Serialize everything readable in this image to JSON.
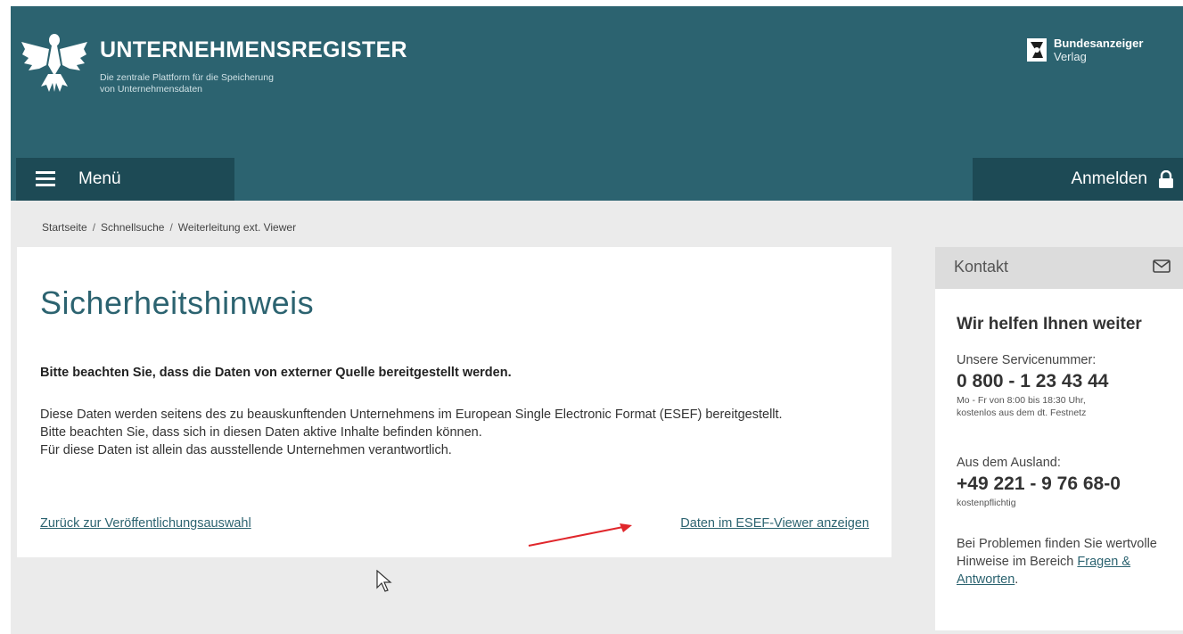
{
  "header": {
    "title": "UNTERNEHMENSREGISTER",
    "subtitle_line1": "Die zentrale Plattform für die Speicherung",
    "subtitle_line2": "von Unternehmensdaten",
    "publisher_name": "Bundesanzeiger",
    "publisher_sub": "Verlag"
  },
  "nav": {
    "menu_label": "Menü",
    "login_label": "Anmelden"
  },
  "breadcrumb": [
    "Startseite",
    "Schnellsuche",
    "Weiterleitung ext. Viewer"
  ],
  "breadcrumb_sep": "/",
  "main": {
    "title": "Sicherheitshinweis",
    "warning": "Bitte beachten Sie, dass die Daten von externer Quelle bereitgestellt werden.",
    "paragraph1": "Diese Daten werden seitens des zu beauskunftenden Unternehmens im European Single Electronic Format (ESEF) bereitgestellt.",
    "paragraph2": "Bitte beachten Sie, dass sich in diesen Daten aktive Inhalte befinden können.",
    "paragraph3": "Für diese Daten ist allein das ausstellende Unternehmen verantwortlich.",
    "back_link": "Zurück zur Veröffentlichungsauswahl",
    "viewer_link": "Daten im ESEF-Viewer anzeigen"
  },
  "sidebar": {
    "heading": "Kontakt",
    "help_title": "Wir helfen Ihnen weiter",
    "service_label": "Unsere Servicenummer:",
    "service_number": "0 800 - 1 23 43 44",
    "service_hours_line1": "Mo - Fr von 8:00 bis 18:30 Uhr,",
    "service_hours_line2": "kostenlos aus dem dt. Festnetz",
    "abroad_label": "Aus dem Ausland:",
    "abroad_number": "+49 221 - 9 76 68-0",
    "abroad_cost": "kostenpflichtig",
    "problems_text": "Bei Problemen finden Sie wertvolle Hinweise im Bereich ",
    "faq_link": "Fragen & Antworten",
    "problems_end": "."
  },
  "colors": {
    "header_bg": "#2c6370",
    "nav_bg": "#1d4a55",
    "accent": "#2c6370",
    "arrow": "#e0262b"
  },
  "icons": {
    "logo": "eagle-icon",
    "publisher": "bundesanzeiger-logo-icon",
    "menu": "hamburger-icon",
    "lock": "lock-icon",
    "mail": "mail-icon",
    "cursor": "mouse-pointer-icon",
    "annotation": "red-arrow-icon"
  }
}
